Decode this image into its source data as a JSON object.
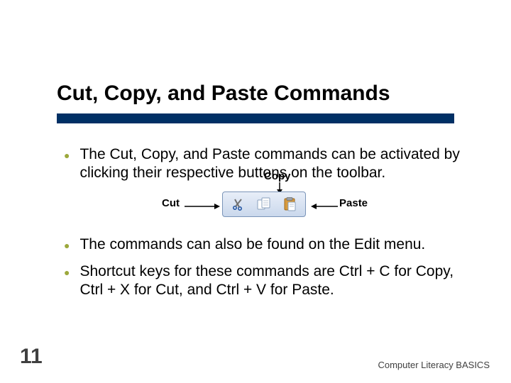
{
  "slide": {
    "number": "11",
    "title": "Cut, Copy, and Paste Commands",
    "footer": "Computer Literacy BASICS"
  },
  "bullets": [
    "The Cut, Copy, and Paste commands can be activated by clicking their respective buttons on the toolbar.",
    "The commands can also be found on the Edit menu.",
    "Shortcut keys for these commands are Ctrl + C for Copy, Ctrl + X for Cut, and Ctrl + V for Paste."
  ],
  "labels": {
    "cut": "Cut",
    "copy": "Copy",
    "paste": "Paste"
  },
  "colors": {
    "underline": "#003065",
    "bullet": "#9ca83c"
  }
}
